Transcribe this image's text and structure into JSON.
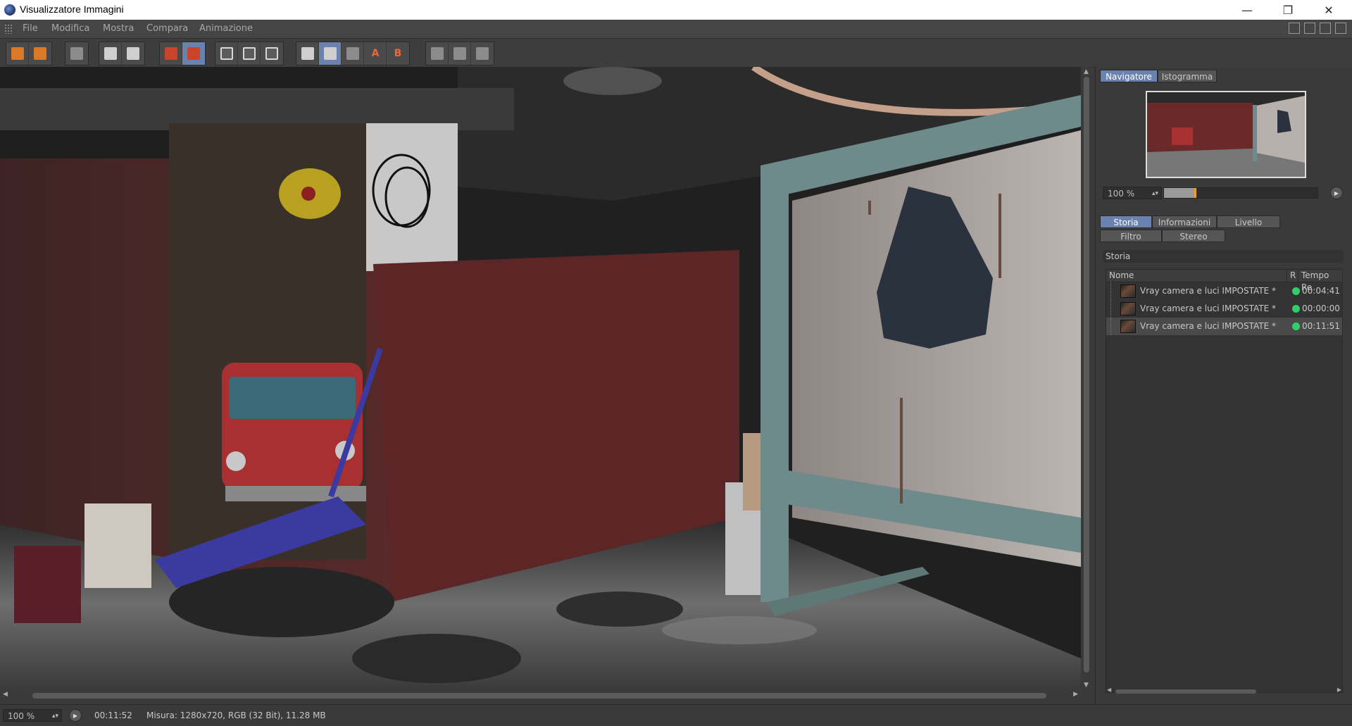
{
  "window": {
    "title": "Visualizzatore Immagini"
  },
  "window_controls": {
    "minimize": "—",
    "restore": "❐",
    "close": "✕"
  },
  "menu": [
    "File",
    "Modifica",
    "Mostra",
    "Compara",
    "Animazione"
  ],
  "toolbar_icons": {
    "group1": [
      "open-icon",
      "save-icon"
    ],
    "group2": [
      "grid-icon"
    ],
    "group3": [
      "fit-icon",
      "magnifier-icon"
    ],
    "group4": [
      "clear-history-icon",
      "delete-image-icon"
    ],
    "group5": [
      "render-region-icon",
      "render-frame-icon",
      "render-pictureviewer-icon"
    ],
    "group6": [
      "compare-ab-icon",
      "compare-split-icon",
      "ab-swap-icon",
      "set-a-icon",
      "set-b-icon"
    ],
    "group7": [
      "channel-left-icon",
      "channel-both-icon",
      "channel-right-icon"
    ]
  },
  "status": {
    "zoom": "100 %",
    "time": "00:11:52",
    "info": "Misura: 1280x720, RGB (32 Bit), 11.28 MB"
  },
  "panel": {
    "top_tabs": [
      "Navigatore",
      "Istogramma"
    ],
    "nav_zoom": "100 %",
    "nav_slider_level": 0.2,
    "bottom_tabs_row1": [
      "Storia",
      "Informazioni",
      "Livello"
    ],
    "bottom_tabs_row2": [
      "Filtro",
      "Stereo"
    ],
    "section_title": "Storia",
    "table": {
      "columns": [
        "Nome",
        "R",
        "Tempo Re"
      ],
      "rows": [
        {
          "name": "Vray camera e luci IMPOSTATE *",
          "status": "green",
          "time": "00:04:41",
          "selected": false
        },
        {
          "name": "Vray camera e luci IMPOSTATE *",
          "status": "green",
          "time": "00:00:00",
          "selected": false
        },
        {
          "name": "Vray camera e luci IMPOSTATE *",
          "status": "green",
          "time": "00:11:51",
          "selected": true
        }
      ]
    }
  },
  "colors": {
    "accent": "#6a82b0",
    "status_green": "#2fd06a",
    "marker_orange": "#f0a020"
  }
}
